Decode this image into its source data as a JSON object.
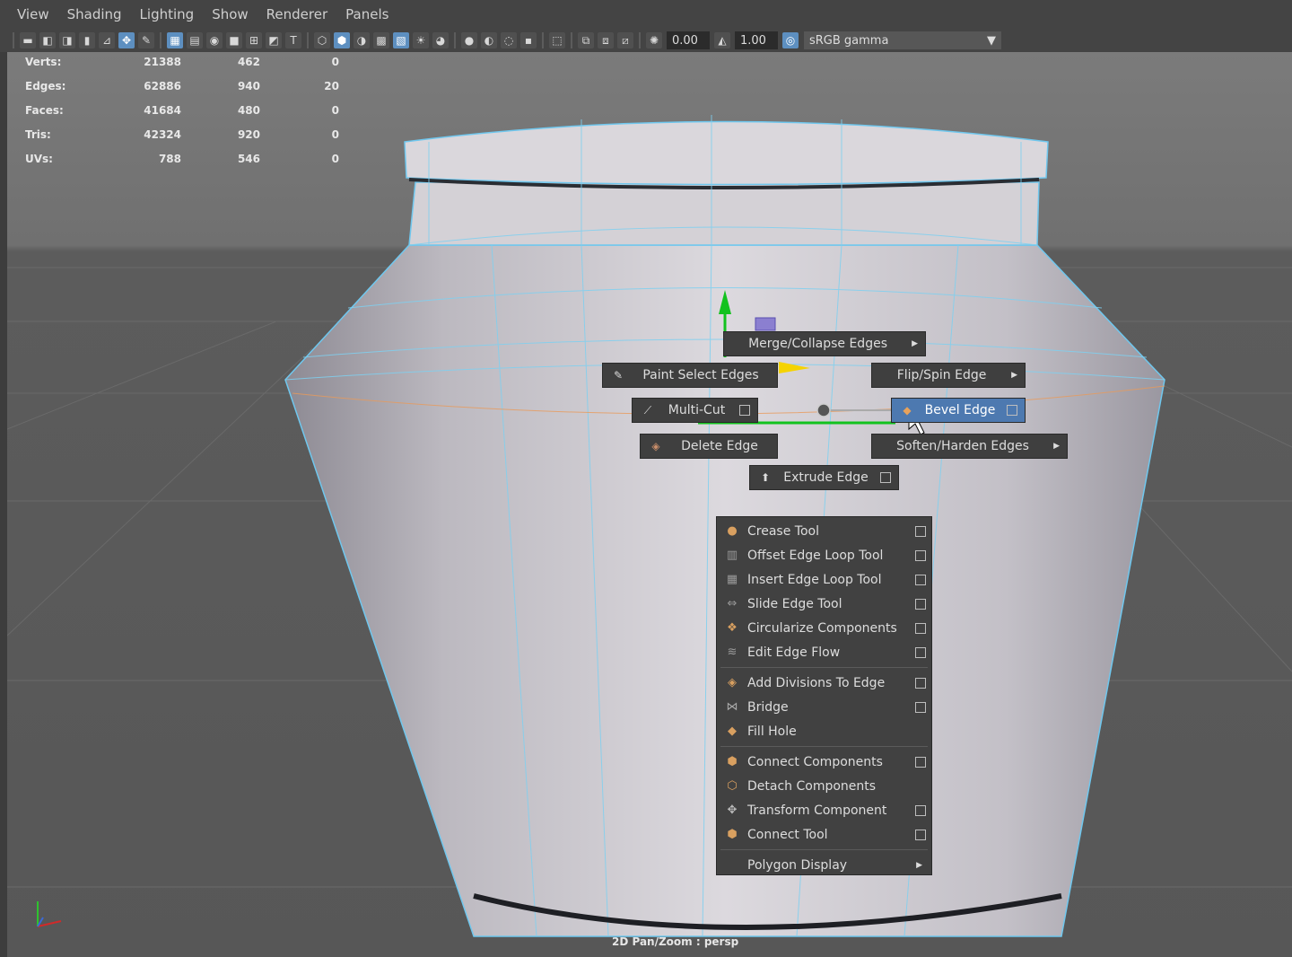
{
  "menubar": {
    "items": [
      "View",
      "Shading",
      "Lighting",
      "Show",
      "Renderer",
      "Panels"
    ]
  },
  "toolbar": {
    "exposure_value": "0.00",
    "gamma_value": "1.00",
    "color_space": "sRGB gamma",
    "icons": [
      "camera-icon",
      "camera-attr-icon",
      "camera-book-icon",
      "bookmark-icon",
      "grid-snap-icon",
      "move-icon",
      "paint-icon",
      "grid-icon",
      "film-gate-icon",
      "resolution-gate-icon",
      "gate-mask-icon",
      "field-chart-icon",
      "safe-action-icon",
      "safe-title-icon",
      "wireframe-icon",
      "smooth-shade-icon",
      "default-material-icon",
      "textured-icon",
      "xray-icon",
      "lights-icon",
      "shadows-icon",
      "ao-icon",
      "motion-blur-icon",
      "aa-icon",
      "dof-icon",
      "isolate-icon",
      "xray-joints-icon",
      "xray-component-icon",
      "toggle-hud-icon",
      "exposure-icon",
      "gamma-icon",
      "color-mgmt-icon"
    ]
  },
  "stats": [
    {
      "label": "Verts:",
      "v1": "21388",
      "v2": "462",
      "v3": "0"
    },
    {
      "label": "Edges:",
      "v1": "62886",
      "v2": "940",
      "v3": "20"
    },
    {
      "label": "Faces:",
      "v1": "41684",
      "v2": "480",
      "v3": "0"
    },
    {
      "label": "Tris:",
      "v1": "42324",
      "v2": "920",
      "v3": "0"
    },
    {
      "label": "UVs:",
      "v1": "788",
      "v2": "546",
      "v3": "0"
    }
  ],
  "marking_menu": {
    "north": "Merge/Collapse Edges",
    "northwest": "Paint Select Edges",
    "northeast": "Flip/Spin Edge",
    "west": "Multi-Cut",
    "east": "Bevel Edge",
    "southwest": "Delete Edge",
    "southeast": "Soften/Harden Edges",
    "south": "Extrude Edge"
  },
  "context_menu": {
    "group1": [
      {
        "label": "Crease Tool",
        "icon": "crease-icon",
        "option": true
      },
      {
        "label": "Offset Edge Loop Tool",
        "icon": "offset-loop-icon",
        "option": true
      },
      {
        "label": "Insert Edge Loop Tool",
        "icon": "insert-loop-icon",
        "option": true
      },
      {
        "label": "Slide Edge Tool",
        "icon": "slide-edge-icon",
        "option": true
      },
      {
        "label": "Circularize Components",
        "icon": "circularize-icon",
        "option": true
      },
      {
        "label": "Edit Edge Flow",
        "icon": "edge-flow-icon",
        "option": true
      }
    ],
    "group2": [
      {
        "label": "Add Divisions To Edge",
        "icon": "add-divisions-icon",
        "option": true
      },
      {
        "label": "Bridge",
        "icon": "bridge-icon",
        "option": true
      },
      {
        "label": "Fill Hole",
        "icon": "fill-hole-icon",
        "option": false
      }
    ],
    "group3": [
      {
        "label": "Connect Components",
        "icon": "connect-components-icon",
        "option": true
      },
      {
        "label": "Detach Components",
        "icon": "detach-components-icon",
        "option": false
      },
      {
        "label": "Transform Component",
        "icon": "transform-component-icon",
        "option": true
      },
      {
        "label": "Connect Tool",
        "icon": "connect-tool-icon",
        "option": true
      }
    ],
    "submenu": "Polygon Display"
  },
  "camera_label": "2D Pan/Zoom : persp",
  "colors": {
    "highlight": "#4d79b0",
    "wire": "#7fd0f0",
    "vase": "#d6d3d8"
  }
}
